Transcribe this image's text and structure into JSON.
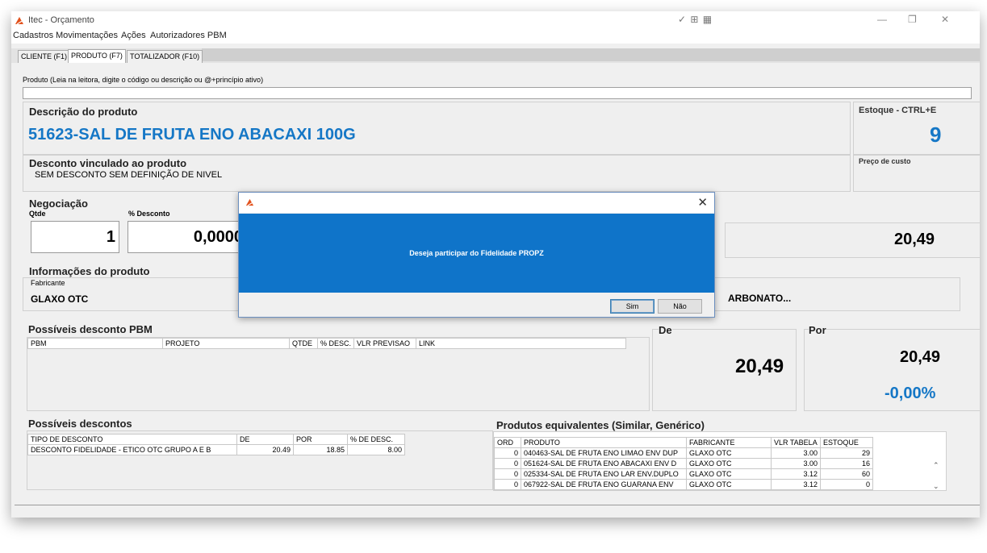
{
  "window": {
    "title": "Itec - Orçamento",
    "tray_icons": "✓ ⊞ ▦",
    "minimize": "—",
    "restore": "❐",
    "close": "✕"
  },
  "menu": [
    "Cadastros",
    "Movimentações",
    "Ações",
    "Autorizadores PBM"
  ],
  "tabs": [
    "CLIENTE (F1)",
    "PRODUTO (F7)",
    "TOTALIZADOR (F10)"
  ],
  "product_input": {
    "label": "Produto (Leia na leitora, digite o código ou descrição ou @+princípio ativo)",
    "value": ""
  },
  "product": {
    "description_label": "Descrição do produto",
    "description": "51623-SAL DE FRUTA ENO ABACAXI 100G",
    "stock_label": "Estoque - CTRL+E",
    "stock": "9",
    "discount_linked_label": "Desconto vinculado ao produto",
    "discount_linked": "SEM DESCONTO SEM DEFINIÇÃO DE NIVEL",
    "cost_label": "Preço de custo"
  },
  "negotiation": {
    "title": "Negociação",
    "qty_label": "Qtde",
    "qty": "1",
    "discount_label": "% Desconto",
    "discount": "0,0000",
    "total": "20,49"
  },
  "product_info": {
    "title": "Informações do produto",
    "manufacturer_label": "Fabricante",
    "manufacturer": "GLAXO OTC",
    "active_ingredient_tail": "ARBONATO..."
  },
  "pbm": {
    "title": "Possíveis desconto PBM",
    "columns": [
      "PBM",
      "PROJETO",
      "QTDE",
      "% DESC.",
      "VLR PREVISAO",
      "LINK"
    ]
  },
  "price": {
    "de_label": "De",
    "de_value": "20,49",
    "por_label": "Por",
    "por_value": "20,49",
    "por_percent": "-0,00%"
  },
  "discounts": {
    "title": "Possíveis descontos",
    "columns": [
      "TIPO DE DESCONTO",
      "DE",
      "POR",
      "% DE DESC."
    ],
    "rows": [
      [
        "DESCONTO FIDELIDADE - ETICO OTC GRUPO A E B",
        "20.49",
        "18.85",
        "8.00"
      ]
    ]
  },
  "equivalents": {
    "title": "Produtos equivalentes (Similar, Genérico)",
    "columns": [
      "ORD",
      "PRODUTO",
      "FABRICANTE",
      "VLR TABELA",
      "ESTOQUE"
    ],
    "rows": [
      [
        "0",
        "040463-SAL DE FRUTA ENO LIMAO ENV DUP",
        "GLAXO OTC",
        "3.00",
        "29"
      ],
      [
        "0",
        "051624-SAL DE FRUTA ENO ABACAXI ENV D",
        "GLAXO OTC",
        "3.00",
        "16"
      ],
      [
        "0",
        "025334-SAL DE FRUTA ENO LAR ENV.DUPLO",
        "GLAXO OTC",
        "3.12",
        "60"
      ],
      [
        "0",
        "067922-SAL DE FRUTA ENO GUARANA ENV",
        "GLAXO OTC",
        "3.12",
        "0"
      ]
    ]
  },
  "dialog": {
    "message": "Deseja participar do Fidelidade PROPZ",
    "yes": "Sim",
    "no": "Não",
    "close": "✕"
  },
  "colors": {
    "accent_blue": "#1577c6",
    "dialog_blue": "#0f74c9"
  }
}
